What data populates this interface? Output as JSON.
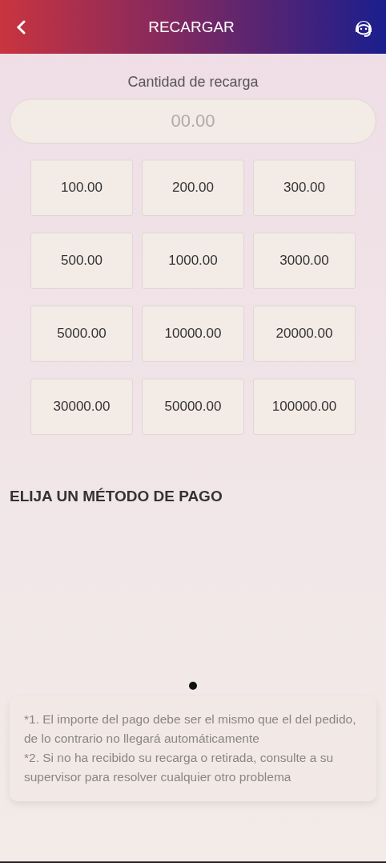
{
  "header": {
    "title": "RECARGAR"
  },
  "amount": {
    "label": "Cantidad de recarga",
    "placeholder": "00.00"
  },
  "presets": [
    "100.00",
    "200.00",
    "300.00",
    "500.00",
    "1000.00",
    "3000.00",
    "5000.00",
    "10000.00",
    "20000.00",
    "30000.00",
    "50000.00",
    "100000.00"
  ],
  "payment": {
    "heading": "ELIJA UN MÉTODO DE PAGO",
    "pager": [
      {
        "selected": true
      }
    ]
  },
  "notes": [
    "*1. El importe del pago debe ser el mismo que el del pedido, de lo contrario no llegará automáticamente",
    "*2. Si no ha recibido su recarga o retirada, consulte a su supervisor para resolver cualquier otro problema"
  ]
}
